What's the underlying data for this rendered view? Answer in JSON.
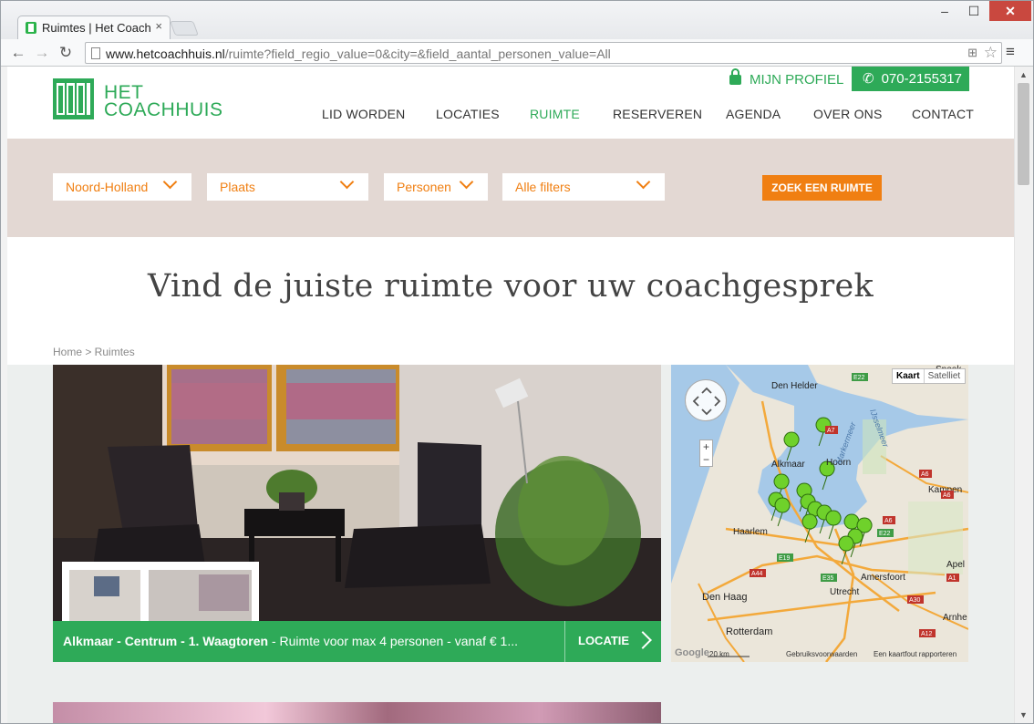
{
  "browser": {
    "tab_title": "Ruimtes | Het Coachi",
    "tab_close": "×",
    "url_host": "www.hetcoachhuis.nl",
    "url_path": "/ruimte?field_regio_value=0&city=&field_aantal_personen_value=All",
    "window_min": "–",
    "window_max": "☐",
    "window_close": "✕"
  },
  "header": {
    "logo_line1": "HET",
    "logo_line2": "COACHHUIS",
    "profile_label": "MIJN PROFIEL",
    "phone": "070-2155317",
    "nav": [
      "LID WORDEN",
      "LOCATIES",
      "RUIMTE",
      "RESERVEREN",
      "AGENDA",
      "OVER ONS",
      "CONTACT"
    ],
    "active_nav": "RUIMTE"
  },
  "filters": {
    "region": "Noord-Holland",
    "place": "Plaats",
    "persons": "Personen",
    "all": "Alle filters",
    "search_button": "ZOEK EEN RUIMTE"
  },
  "hero": {
    "title": "Vind de juiste ruimte voor uw coachgesprek"
  },
  "breadcrumb": "Home > Ruimtes",
  "listing": {
    "title_bold": "Alkmaar - Centrum - 1. Waagtoren",
    "title_rest": " - Ruimte voor max 4 personen - vanaf € 1...",
    "location_button": "LOCATIE"
  },
  "map": {
    "type_map": "Kaart",
    "type_satellite": "Satelliet",
    "zoom_in": "+",
    "zoom_out": "−",
    "places": [
      "Sneek",
      "Den Helder",
      "Hoorn",
      "Alkmaar",
      "Kampen",
      "Haarlem",
      "Apel",
      "Amersfoort",
      "Den Haag",
      "Utrecht",
      "Rotterdam",
      "Arnhe"
    ],
    "roads": [
      "E22",
      "A7",
      "A6",
      "A6",
      "A6",
      "E22",
      "E19",
      "A44",
      "E35",
      "A1",
      "A30",
      "A12"
    ],
    "lake_labels": [
      "IJsselmeer",
      "Markermeer"
    ],
    "scale": "20 km",
    "terms": "Gebruiksvoorwaarden",
    "report": "Een kaartfout rapporteren",
    "provider": "Google"
  },
  "colors": {
    "brand_green": "#2eaa58",
    "accent_orange": "#f07f12",
    "filter_band": "#e3d8d3"
  }
}
